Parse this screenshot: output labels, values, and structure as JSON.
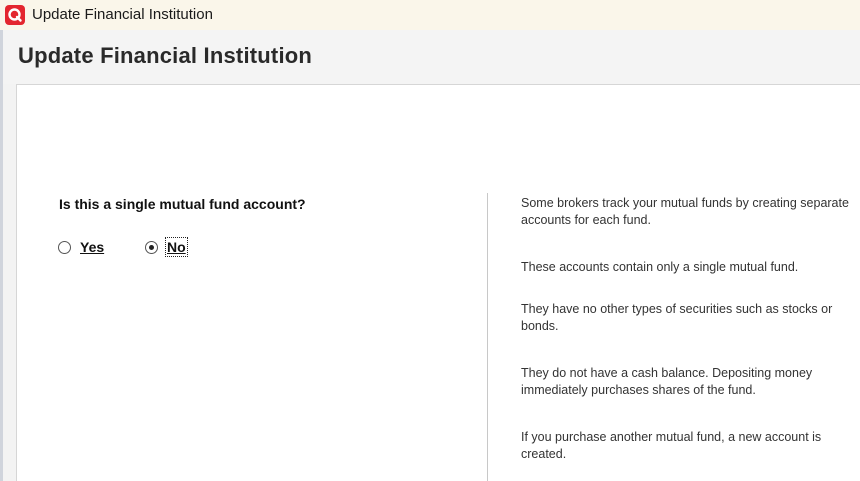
{
  "window": {
    "title": "Update Financial Institution",
    "app_icon": "quicken-icon"
  },
  "header": {
    "title": "Update Financial Institution"
  },
  "form": {
    "question": "Is this a single mutual fund account?",
    "options": [
      {
        "label": "Yes",
        "selected": false
      },
      {
        "label": "No",
        "selected": true
      }
    ]
  },
  "help": {
    "paragraphs": [
      "Some brokers track your mutual funds by creating separate accounts for each fund.",
      "These accounts contain only a single mutual fund.",
      "They have no other types of securities such as stocks or bonds.",
      "They do not have a cash balance. Depositing money immediately purchases shares of the fund.",
      "If you purchase another mutual fund, a new account is created."
    ]
  },
  "colors": {
    "brand": "#e3262f",
    "titlebar": "#faf6ea",
    "header_bg": "#f4f4f4"
  }
}
